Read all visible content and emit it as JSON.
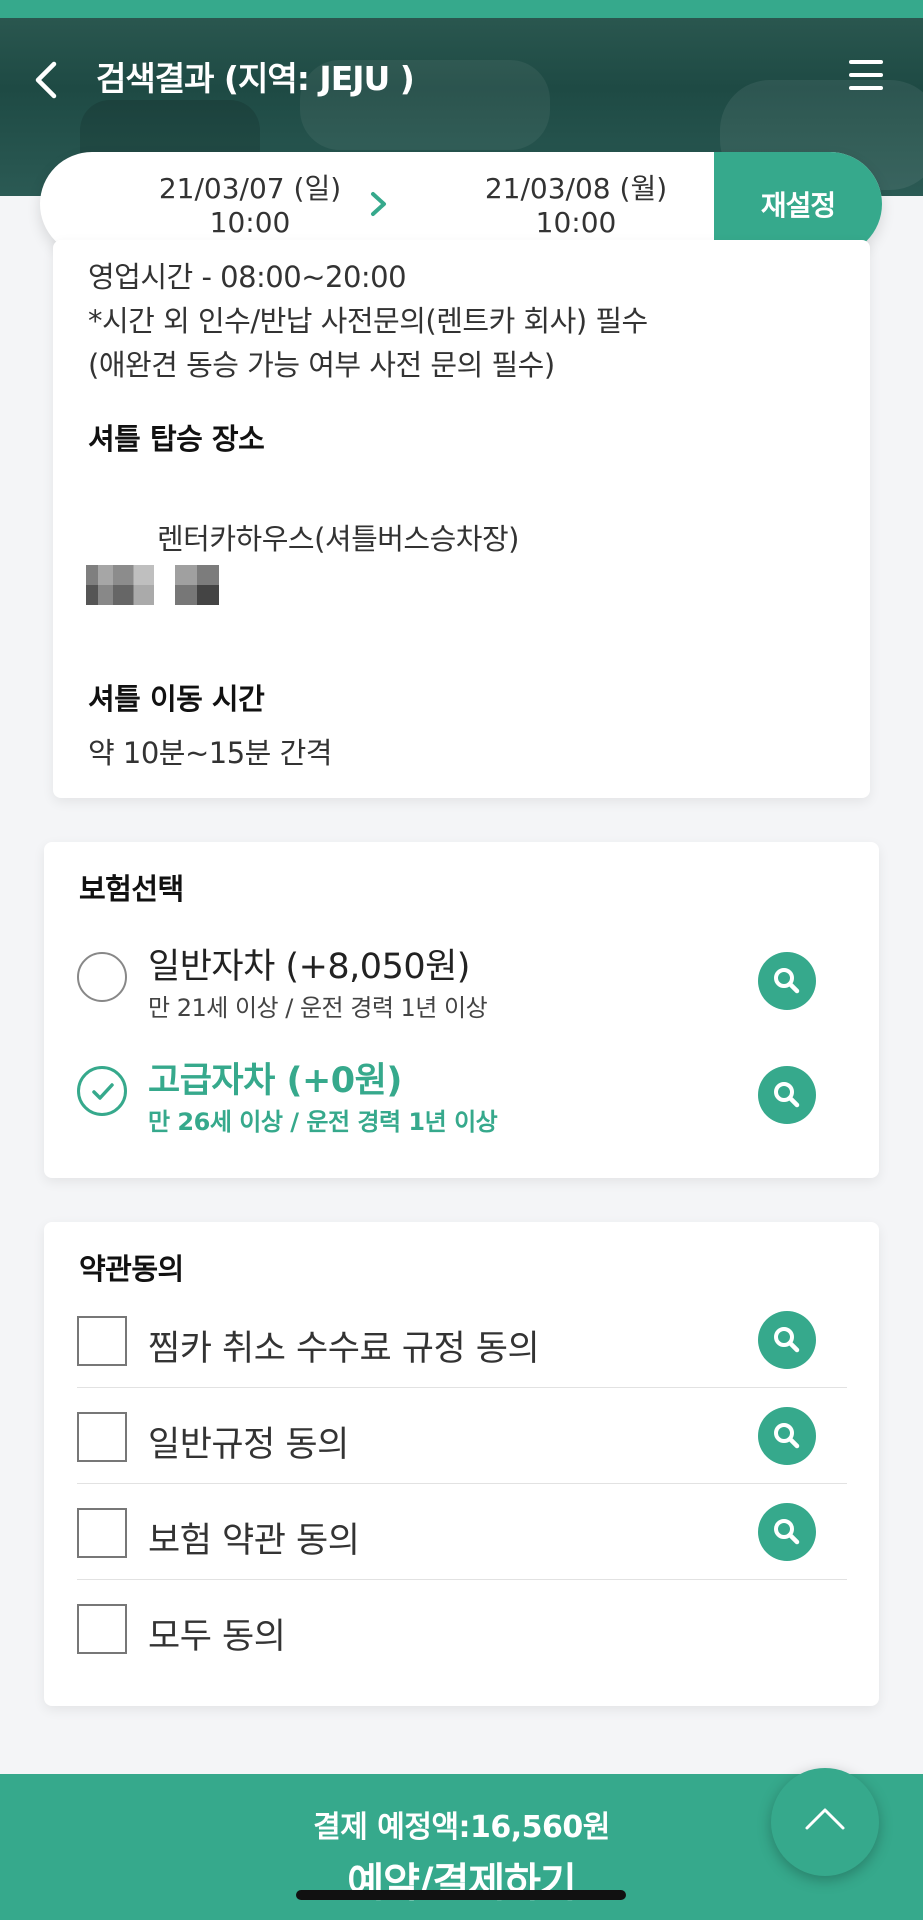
{
  "header": {
    "title": "검색결과 (지역: JEJU )",
    "back_icon": "chevron-left-icon",
    "menu_icon": "hamburger-menu-icon"
  },
  "date_range": {
    "start_date": "21/03/07 (일)",
    "start_time": "10:00",
    "end_date": "21/03/08 (월)",
    "end_time": "10:00",
    "reset_label": "재설정"
  },
  "info": {
    "hours": "영업시간 - 08:00~20:00",
    "notice1": "*시간 외 인수/반납 사전문의(렌트카 회사) 필수",
    "notice2": "(애완견 동승 가능 여부 사전 문의 필수)",
    "shuttle_place_title": "셔틀 탑승 장소",
    "shuttle_place": "렌터카하우스(셔틀버스승차장)",
    "shuttle_time_title": "셔틀 이동 시간",
    "shuttle_time": "약 10분~15분 간격"
  },
  "insurance": {
    "title": "보험선택",
    "options": [
      {
        "name": "일반자차 (+8,050원)",
        "sub": "만 21세 이상 / 운전 경력 1년 이상",
        "selected": false
      },
      {
        "name": "고급자차 (+0원)",
        "sub": "만 26세 이상 / 운전 경력 1년 이상",
        "selected": true
      }
    ]
  },
  "terms": {
    "title": "약관동의",
    "items": [
      {
        "label": "찜카 취소 수수료 규정 동의",
        "checked": false
      },
      {
        "label": "일반규정 동의",
        "checked": false
      },
      {
        "label": "보험 약관 동의",
        "checked": false
      },
      {
        "label": "모두 동의",
        "checked": false
      }
    ]
  },
  "payment": {
    "amount_text": "결제 예정액:16,560원",
    "button_label": "예약/결제하기"
  },
  "colors": {
    "accent": "#36a98c",
    "header_bg": "#2d5a52"
  }
}
